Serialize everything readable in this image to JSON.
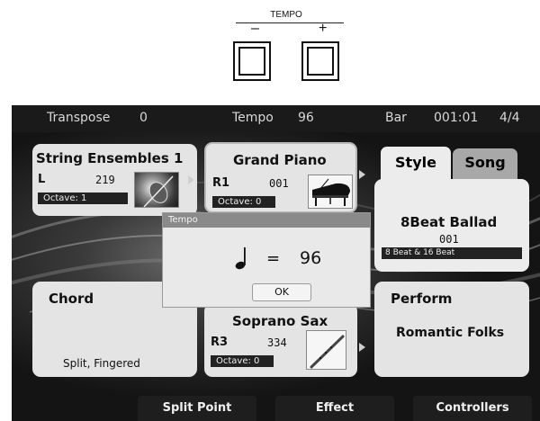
{
  "hardware": {
    "tempo_caption": "TEMPO",
    "minus_symbol": "–",
    "plus_symbol": "+"
  },
  "status_bar": {
    "transpose_label": "Transpose",
    "transpose_value": "0",
    "tempo_label": "Tempo",
    "tempo_value": "96",
    "bar_label": "Bar",
    "bar_value": "001:01",
    "time_signature": "4/4"
  },
  "voices": {
    "left": {
      "name": "String Ensembles 1",
      "part": "L",
      "number": "219",
      "octave": "Octave:  1",
      "thumb_icon": "violin-photo-icon"
    },
    "r1": {
      "name": "Grand Piano",
      "part": "R1",
      "number": "001",
      "octave": "Octave:  0",
      "thumb_icon": "grand-piano-icon"
    },
    "r3": {
      "name": "Soprano Sax",
      "part": "R3",
      "number": "334",
      "octave": "Octave:  0",
      "thumb_icon": "saxophone-icon"
    }
  },
  "style_panel": {
    "tabs": [
      {
        "label": "Style",
        "active": true
      },
      {
        "label": "Song",
        "active": false
      }
    ],
    "style_name": "8Beat Ballad",
    "style_number": "001",
    "style_category": "8 Beat & 16 Beat"
  },
  "chord_panel": {
    "title": "Chord",
    "mode": "Split, Fingered"
  },
  "perform_panel": {
    "title": "Perform",
    "value": "Romantic Folks"
  },
  "tempo_dialog": {
    "title": "Tempo",
    "note_icon": "quarter-note-icon",
    "equals": "=",
    "value": "96",
    "ok_label": "OK"
  },
  "soft_buttons": {
    "split_point": "Split Point",
    "effect": "Effect",
    "controllers": "Controllers"
  },
  "colors": {
    "panel": "#e4e4e4",
    "status_bar": "#1a1a1a",
    "dialog_title": "#8a8a8a"
  }
}
